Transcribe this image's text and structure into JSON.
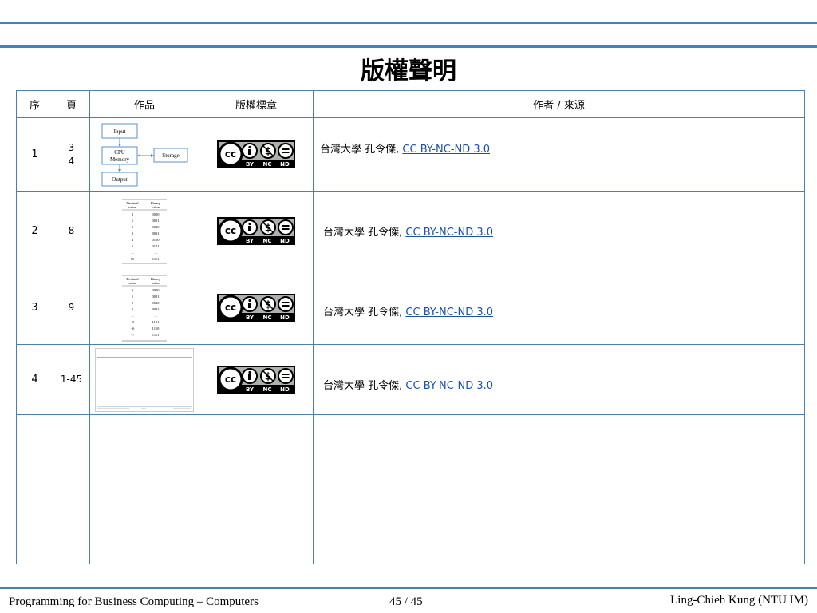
{
  "title": "版權聲明",
  "table": {
    "headers": [
      "序",
      "頁",
      "作品",
      "版權標章",
      "作者 / 來源"
    ],
    "rows": [
      {
        "no": "1",
        "pages": [
          "3",
          "4"
        ],
        "author": "台灣大學 孔令傑, ",
        "license": "CC BY-NC-ND 3.0"
      },
      {
        "no": "2",
        "pages": [
          "8"
        ],
        "author": "台灣大學 孔令傑, ",
        "license": "CC BY-NC-ND 3.0"
      },
      {
        "no": "3",
        "pages": [
          "9"
        ],
        "author": "台灣大學 孔令傑, ",
        "license": "CC BY-NC-ND 3.0"
      },
      {
        "no": "4",
        "pages": [
          "1-45"
        ],
        "author": "台灣大學 孔令傑, ",
        "license": "CC BY-NC-ND 3.0"
      }
    ]
  },
  "thumb1": {
    "input": "Input",
    "cpu": "CPU",
    "memory": "Memory",
    "storage": "Storage",
    "output": "Output"
  },
  "thumb2": {
    "headers": [
      "Decimal",
      "value",
      "Binary",
      "value"
    ],
    "rows": [
      [
        "0",
        "0000"
      ],
      [
        "1",
        "0001"
      ],
      [
        "2",
        "0010"
      ],
      [
        "3",
        "0011"
      ],
      [
        "4",
        "0100"
      ],
      [
        "5",
        "0101"
      ],
      [
        "...",
        "..."
      ],
      [
        "15",
        "1111"
      ]
    ]
  },
  "thumb3": {
    "headers": [
      "Decimal",
      "value",
      "Binary",
      "value"
    ],
    "rows": [
      [
        "0",
        "0000"
      ],
      [
        "1",
        "0001"
      ],
      [
        "2",
        "0010"
      ],
      [
        "3",
        "0011"
      ],
      [
        "...",
        "..."
      ],
      [
        "−5",
        "1101"
      ],
      [
        "−6",
        "1110"
      ],
      [
        "−7",
        "1111"
      ]
    ]
  },
  "badge": {
    "cc": "cc",
    "by": "BY",
    "nc": "NC",
    "nd": "ND"
  },
  "footer": {
    "left": "Programming for Business Computing – Computers",
    "center": "45 / 45",
    "right": "Ling-Chieh Kung (NTU IM)"
  },
  "colors": {
    "rule": "#4a7ebb",
    "link": "#1a4fb8"
  }
}
